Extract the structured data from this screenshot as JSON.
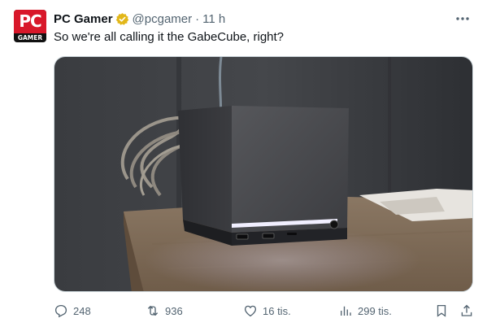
{
  "tweet": {
    "author_name": "PC Gamer",
    "handle": "@pcgamer",
    "separator": "·",
    "time": "11 h",
    "text": "So we're all calling it the GabeCube, right?",
    "avatar": {
      "logo_top": "PC",
      "logo_bottom": "GAMER",
      "brand_color": "#d8182a"
    },
    "verified_badge_color": "#e2b719",
    "media_description_icon": "photo"
  },
  "actions": {
    "replies": "248",
    "reposts": "936",
    "likes": "16 tis.",
    "views": "299 tis."
  },
  "colors": {
    "text_primary": "#0f1419",
    "text_secondary": "#536471",
    "border": "#cfd9de"
  }
}
